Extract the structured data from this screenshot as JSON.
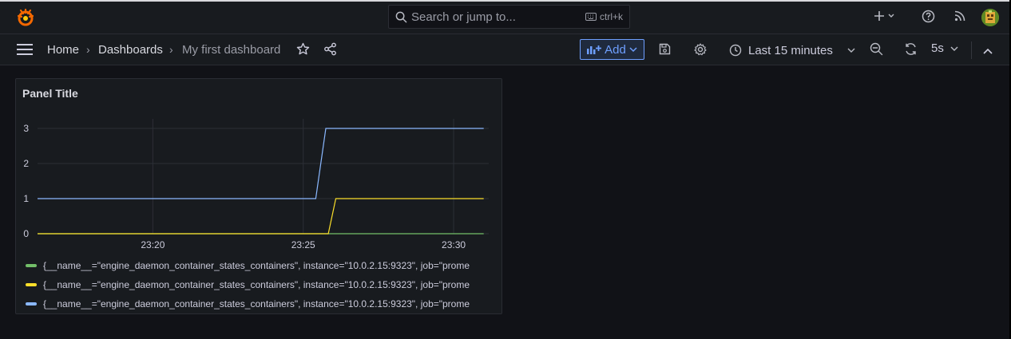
{
  "topbar": {
    "search_placeholder": "Search or jump to...",
    "search_shortcut": "ctrl+k",
    "icons": [
      "grafana-logo-icon",
      "search-icon",
      "keyboard-icon",
      "plus-icon",
      "help-icon",
      "news-icon",
      "avatar"
    ]
  },
  "nav": {
    "breadcrumbs": [
      "Home",
      "Dashboards",
      "My first dashboard"
    ],
    "add_label": "Add",
    "time_range": "Last 15 minutes",
    "refresh_interval": "5s"
  },
  "panel": {
    "title": "Panel Title"
  },
  "colors": {
    "accent": "#6e9fff",
    "series_green": "#73bf69",
    "series_yellow": "#fade2a",
    "series_blue": "#8ab8ff"
  },
  "chart_data": {
    "type": "line",
    "x_ticks": [
      "23:20",
      "23:25",
      "23:30"
    ],
    "y_ticks": [
      "0",
      "1",
      "2",
      "3"
    ],
    "xlim": [
      "23:16:10",
      "23:31:10"
    ],
    "ylim": [
      0,
      3
    ],
    "series": [
      {
        "name": "{__name__=\"engine_daemon_container_states_containers\", instance=\"10.0.2.15:9323\", job=\"prome",
        "color": "#73bf69",
        "points": [
          [
            "23:16:10",
            0
          ],
          [
            "23:31:00",
            0
          ]
        ]
      },
      {
        "name": "{__name__=\"engine_daemon_container_states_containers\", instance=\"10.0.2.15:9323\", job=\"prome",
        "color": "#fade2a",
        "points": [
          [
            "23:16:10",
            0
          ],
          [
            "23:25:50",
            0
          ],
          [
            "23:26:05",
            1
          ],
          [
            "23:31:00",
            1
          ]
        ]
      },
      {
        "name": "{__name__=\"engine_daemon_container_states_containers\", instance=\"10.0.2.15:9323\", job=\"prome",
        "color": "#8ab8ff",
        "points": [
          [
            "23:16:10",
            1
          ],
          [
            "23:25:25",
            1
          ],
          [
            "23:25:45",
            3
          ],
          [
            "23:31:00",
            3
          ]
        ]
      }
    ]
  }
}
